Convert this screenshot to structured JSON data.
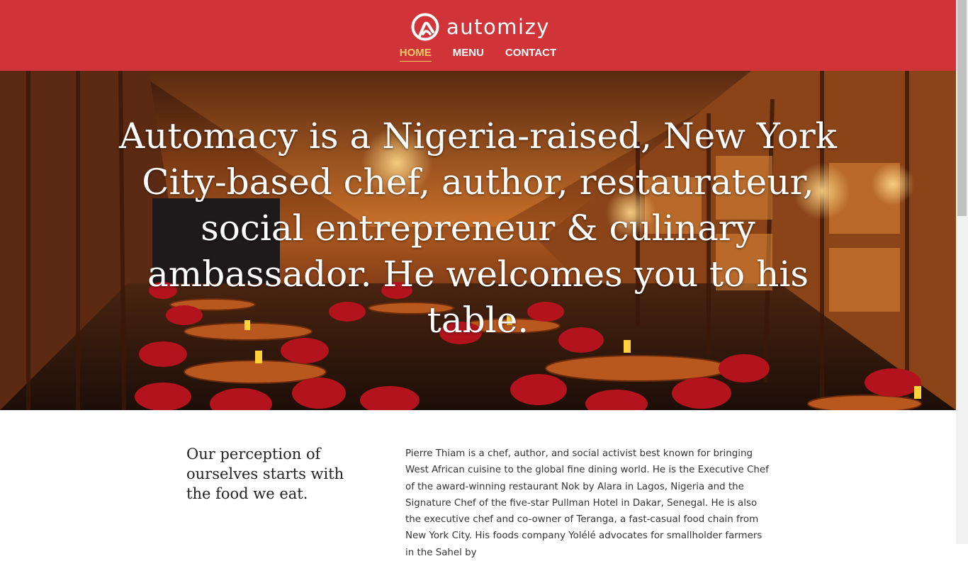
{
  "brand": {
    "logo_icon": "automizy-logo-icon",
    "name": "automizy",
    "color": "#d03438"
  },
  "nav": {
    "items": [
      {
        "label": "HOME",
        "active": true
      },
      {
        "label": "MENU",
        "active": false
      },
      {
        "label": "CONTACT",
        "active": false
      }
    ],
    "active_color": "#f5c96b"
  },
  "hero": {
    "headline": "Automacy is a Nigeria-raised, New York City-based chef, author, restaurateur, social entrepreneur & culinary ambassador. He welcomes you to his table.",
    "image": "restaurant interior with wooden walls, red chairs and round tables"
  },
  "content": {
    "tagline": "Our perception of ourselves starts with the food we eat.",
    "bio": "Pierre Thiam is a chef, author, and social activist best known for bringing West African cuisine to the global fine dining world. He is the Executive Chef of the award-winning restaurant Nok by Alara in Lagos, Nigeria and the Signature Chef of the five-star Pullman Hotel in Dakar, Senegal. He is also the executive chef and co-owner of Teranga, a fast-casual food chain from New York City. His foods company Yolélé advocates for smallholder farmers in the Sahel by"
  }
}
